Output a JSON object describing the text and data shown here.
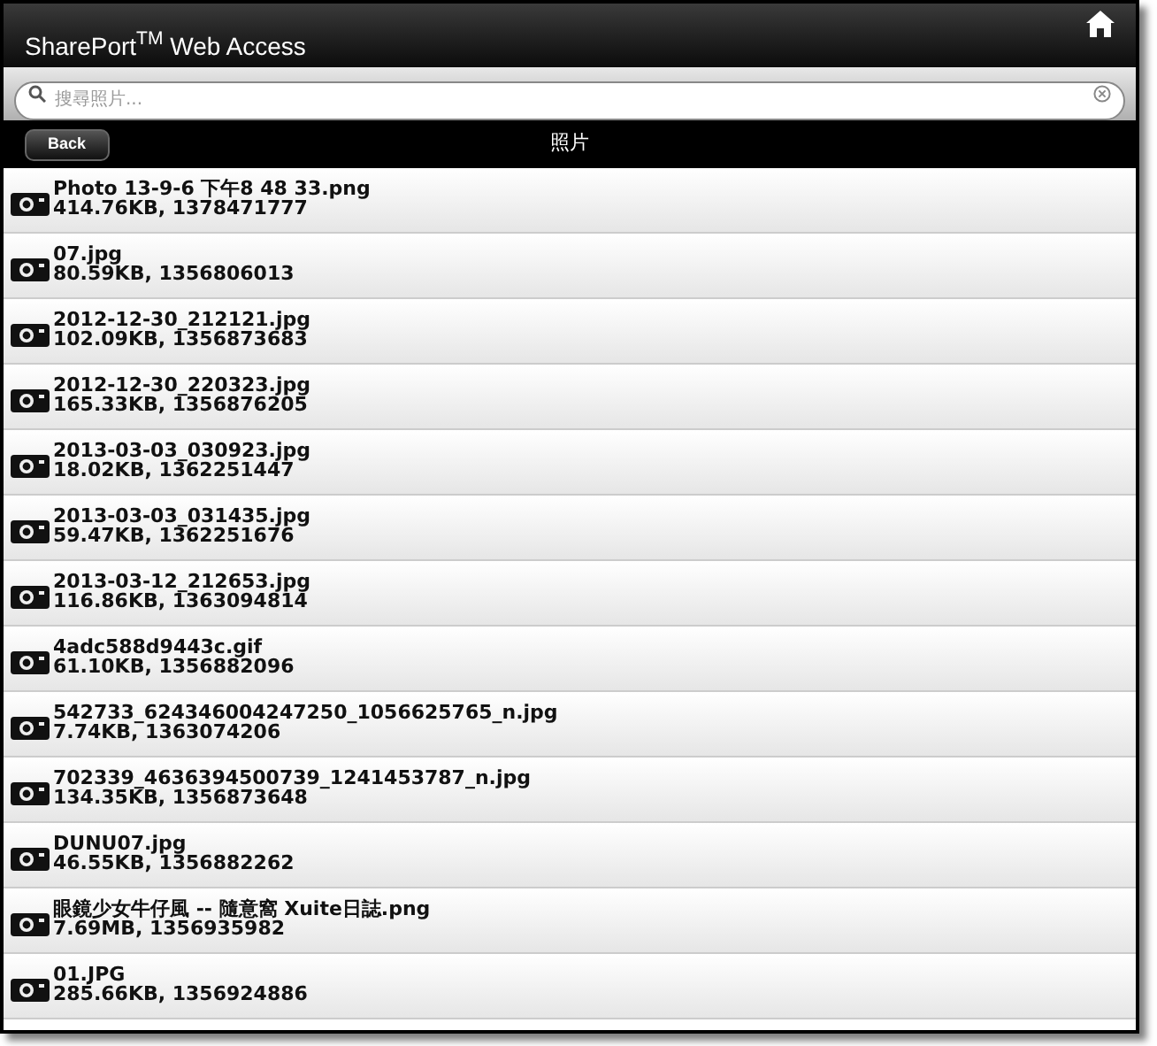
{
  "header": {
    "title": "SharePort$^{TM}$ Web Access"
  },
  "search": {
    "placeholder": "搜尋照片..."
  },
  "nav": {
    "back": "Back",
    "title": "照片"
  },
  "files": [
    {
      "name": "Photo 13-9-6 下午8 48 33.png",
      "info": "414.76KB, 1378471777"
    },
    {
      "name": "07.jpg",
      "info": "80.59KB, 1356806013"
    },
    {
      "name": "2012-12-30_212121.jpg",
      "info": "102.09KB, 1356873683"
    },
    {
      "name": "2012-12-30_220323.jpg",
      "info": "165.33KB, 1356876205"
    },
    {
      "name": "2013-03-03_030923.jpg",
      "info": "18.02KB, 1362251447"
    },
    {
      "name": "2013-03-03_031435.jpg",
      "info": "59.47KB, 1362251676"
    },
    {
      "name": "2013-03-12_212653.jpg",
      "info": "116.86KB, 1363094814"
    },
    {
      "name": "4adc588d9443c.gif",
      "info": "61.10KB, 1356882096"
    },
    {
      "name": "542733_624346004247250_1056625765_n.jpg",
      "info": "7.74KB, 1363074206"
    },
    {
      "name": "702339_4636394500739_1241453787_n.jpg",
      "info": "134.35KB, 1356873648"
    },
    {
      "name": "DUNU07.jpg",
      "info": "46.55KB, 1356882262"
    },
    {
      "name": "眼鏡少女牛仔風 -- 隨意窩 Xuite日誌.png",
      "info": "7.69MB, 1356935982"
    },
    {
      "name": "01.JPG",
      "info": "285.66KB, 1356924886"
    }
  ]
}
